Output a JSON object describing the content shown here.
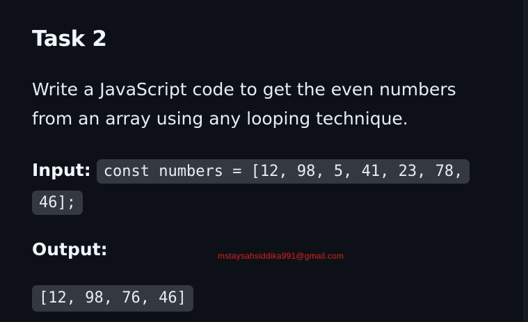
{
  "task": {
    "title": "Task 2",
    "description": "Write a JavaScript code to get the even numbers from an array using any looping technique.",
    "input_label": "Input:",
    "input_code": "const numbers = [12, 98, 5, 41, 23, 78, 46];",
    "output_label": "Output:",
    "output_code": "[12, 98, 76, 46]"
  },
  "watermark": "mstaysahsiddika991@gmail.com",
  "colors": {
    "background": "#0d1117",
    "text": "#e6edf3",
    "code_background": "#343941",
    "watermark": "#e0201a"
  }
}
